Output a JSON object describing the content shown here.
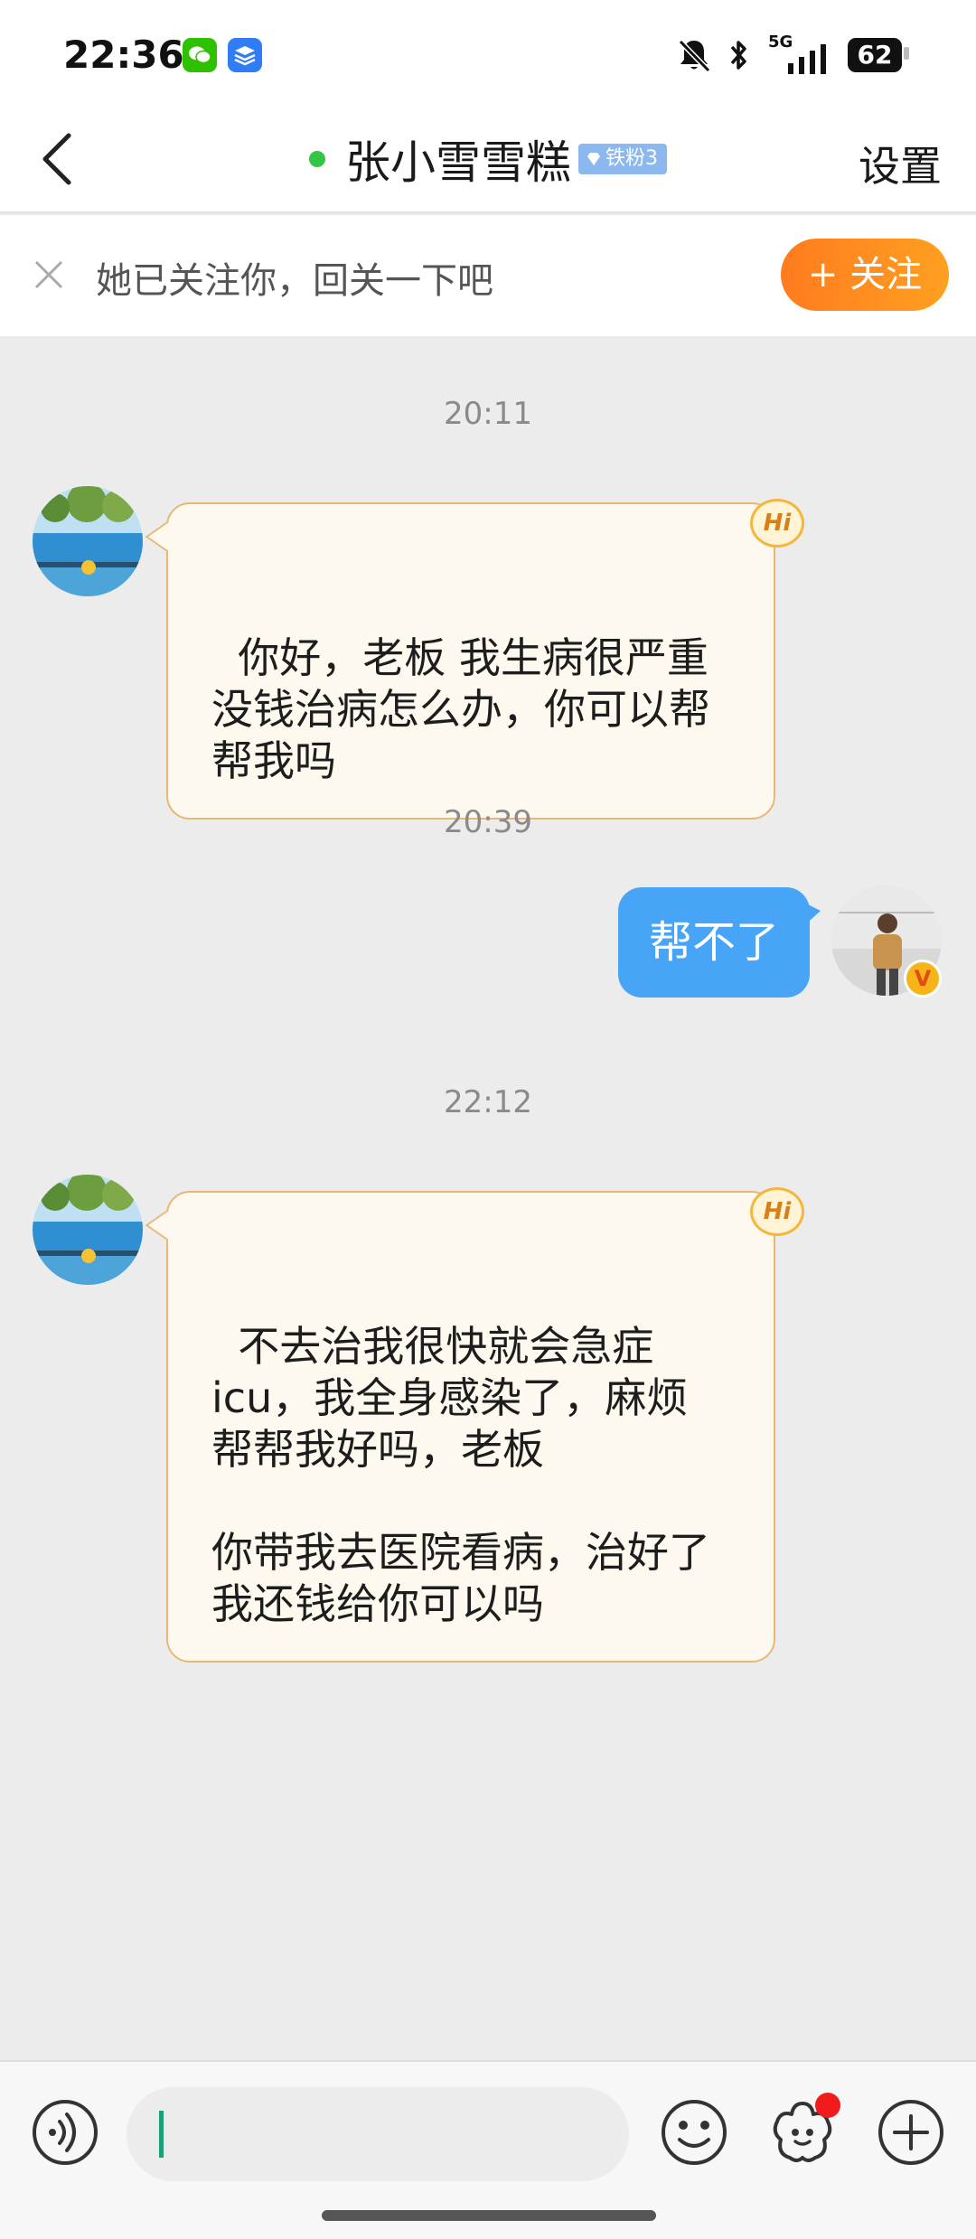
{
  "status_bar": {
    "time": "22:36",
    "network": "5G",
    "battery": "62",
    "icons": [
      "wechat-icon",
      "layers-app-icon",
      "mute-bell-icon",
      "bluetooth-icon",
      "signal-icon",
      "battery-icon"
    ]
  },
  "header": {
    "title": "张小雪雪糕",
    "fan_badge": "铁粉3",
    "settings_label": "设置",
    "online": true,
    "online_color": "#35c44a"
  },
  "follow_bar": {
    "text": "她已关注你，回关一下吧",
    "button_label": "+ 关注",
    "button_color": "#ff8a1f"
  },
  "messages": [
    {
      "type": "timestamp",
      "text": "20:11"
    },
    {
      "type": "incoming",
      "text": "你好，老板 我生病很严重\n没钱治病怎么办，你可以帮\n帮我吗",
      "badge": "Hi"
    },
    {
      "type": "timestamp",
      "text": "20:39"
    },
    {
      "type": "outgoing",
      "text": "帮不了",
      "badge": "V"
    },
    {
      "type": "timestamp",
      "text": "22:12"
    },
    {
      "type": "incoming",
      "text": "不去治我很快就会急症\nicu，我全身感染了，麻烦\n帮帮我好吗，老板\n\n你带我去医院看病，治好了\n我还钱给你可以吗",
      "badge": "Hi"
    }
  ],
  "input_bar": {
    "input_value": "",
    "icons": [
      "voice-icon",
      "emoji-icon",
      "sticker-icon",
      "plus-icon"
    ],
    "has_notification_dot": true
  },
  "colors": {
    "incoming_bubble_bg": "#fdf9ef",
    "incoming_bubble_border": "#e9b774",
    "outgoing_bubble_bg": "#47a4f7",
    "chat_bg": "#ececec"
  }
}
